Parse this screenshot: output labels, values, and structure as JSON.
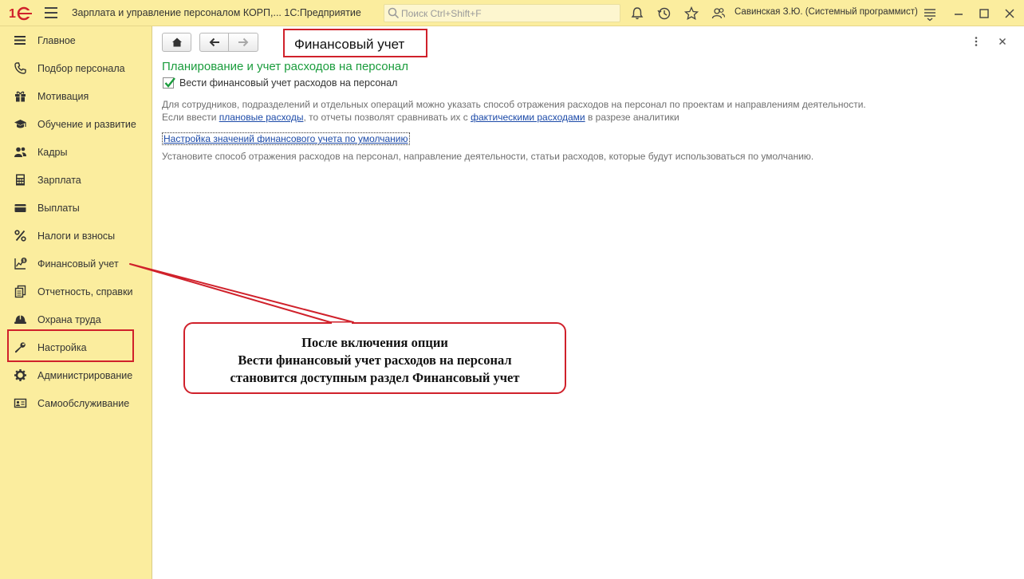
{
  "header": {
    "logo_text": "1С",
    "app_title": "Зарплата и управление персоналом КОРП,...  1С:Предприятие",
    "search_placeholder": "Поиск Ctrl+Shift+F",
    "user_name": "Савинская З.Ю. (Системный программист)",
    "icons": [
      "hamburger-icon",
      "search-icon",
      "bell-icon",
      "history-icon",
      "star-icon",
      "users-icon",
      "settings-lines-icon",
      "minimize-icon",
      "maximize-icon",
      "close-icon"
    ]
  },
  "sidebar": {
    "items": [
      {
        "label": "Главное",
        "icon": "menu-lines-icon"
      },
      {
        "label": "Подбор персонала",
        "icon": "phone-icon"
      },
      {
        "label": "Мотивация",
        "icon": "gift-icon"
      },
      {
        "label": "Обучение и развитие",
        "icon": "graduation-cap-icon"
      },
      {
        "label": "Кадры",
        "icon": "people-icon"
      },
      {
        "label": "Зарплата",
        "icon": "calculator-icon"
      },
      {
        "label": "Выплаты",
        "icon": "wallet-icon"
      },
      {
        "label": "Налоги и взносы",
        "icon": "percent-icon"
      },
      {
        "label": "Финансовый учет",
        "icon": "chart-dollar-icon"
      },
      {
        "label": "Отчетность, справки",
        "icon": "documents-icon"
      },
      {
        "label": "Охрана труда",
        "icon": "helmet-icon"
      },
      {
        "label": "Настройка",
        "icon": "wrench-icon"
      },
      {
        "label": "Администрирование",
        "icon": "gear-icon"
      },
      {
        "label": "Самообслуживание",
        "icon": "id-card-icon"
      }
    ],
    "highlighted_item": "Настройка"
  },
  "main": {
    "page_title": "Финансовый учет",
    "section_title": "Планирование и учет расходов на персонал",
    "checkbox": {
      "label": "Вести финансовый учет расходов на персонал",
      "checked": true
    },
    "desc_line1": "Для сотрудников, подразделений и отдельных операций можно указать способ отражения расходов на персонал по проектам и направлениям деятельности.",
    "desc_line2_prefix": "Если ввести ",
    "desc_line2_link1": "плановые расходы",
    "desc_line2_middle": ", то отчеты позволят сравнивать их с ",
    "desc_line2_link2": "фактическими расходами",
    "desc_line2_suffix": " в разрезе аналитики",
    "setup_link": "Настройка значений финансового учета по умолчанию",
    "setup_desc": "Установите способ отражения расходов на персонал, направление деятельности, статьи расходов, которые будут использоваться по умолчанию."
  },
  "callout": {
    "line1": "После включения опции",
    "line2": "Вести финансовый учет расходов на персонал",
    "line3": "становится доступным раздел Финансовый учет"
  },
  "colors": {
    "panel_yellow": "#fbed9e",
    "accent_red": "#d0212b",
    "section_green": "#1a9c3c",
    "link_blue": "#1c4aa8"
  }
}
